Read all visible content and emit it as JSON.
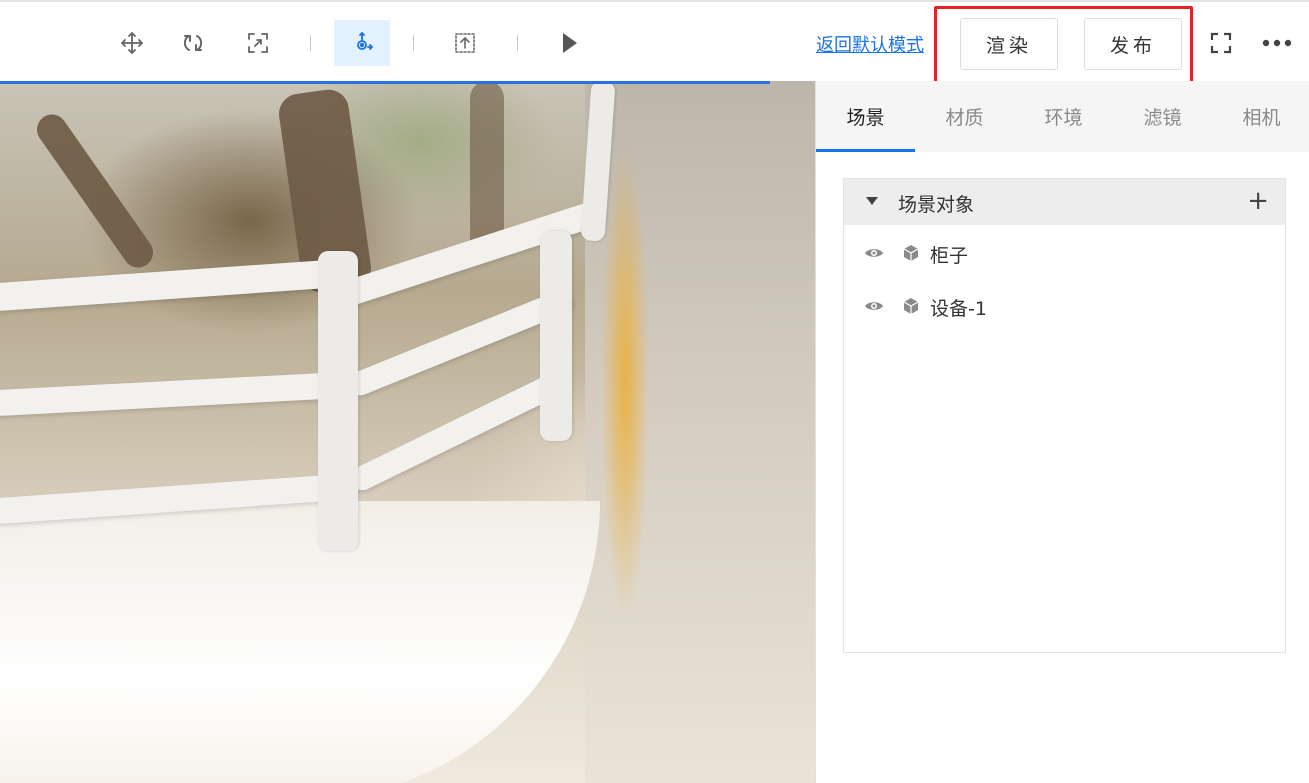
{
  "toolbar": {
    "tools": [
      {
        "name": "move",
        "icon": "move-icon"
      },
      {
        "name": "rotate",
        "icon": "rotate-icon"
      },
      {
        "name": "scale",
        "icon": "scale-icon"
      },
      {
        "name": "pivot",
        "icon": "pivot-icon",
        "active": true
      },
      {
        "name": "upload",
        "icon": "upload-icon"
      },
      {
        "name": "play",
        "icon": "play-icon"
      }
    ],
    "restore_link": "返回默认模式",
    "render_button": "渲染",
    "publish_button": "发布",
    "fullscreen_icon": "fullscreen-icon",
    "more_icon": "more-icon"
  },
  "panel": {
    "tabs": [
      {
        "label": "场景",
        "active": true
      },
      {
        "label": "材质",
        "active": false
      },
      {
        "label": "环境",
        "active": false
      },
      {
        "label": "滤镜",
        "active": false
      },
      {
        "label": "相机",
        "active": false
      }
    ],
    "tree": {
      "title": "场景对象",
      "add_icon": "plus-icon",
      "items": [
        {
          "label": "柜子",
          "visible_icon": "eye-icon",
          "type_icon": "cube-icon"
        },
        {
          "label": "设备-1",
          "visible_icon": "eye-icon",
          "type_icon": "cube-icon"
        }
      ]
    }
  },
  "colors": {
    "accent": "#1a73e8",
    "highlight": "#e8202a",
    "active_tool_bg": "#e3f0fd"
  }
}
